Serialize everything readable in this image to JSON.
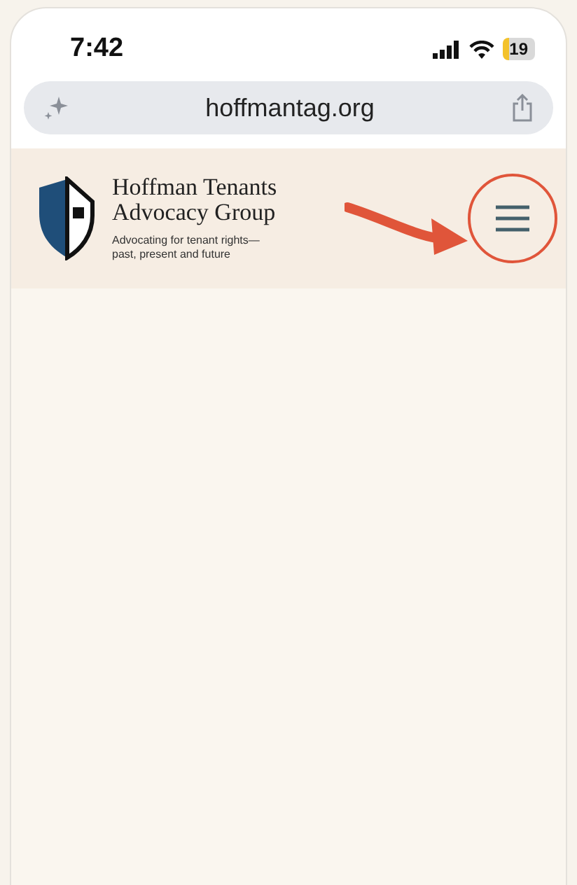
{
  "status_bar": {
    "time": "7:42",
    "battery": "19"
  },
  "url_bar": {
    "address": "hoffmantag.org"
  },
  "header": {
    "title": "Hoffman Tenants Advocacy Group",
    "tagline": "Advocating for tenant rights—past, present and future",
    "menu_highlighted": true
  }
}
